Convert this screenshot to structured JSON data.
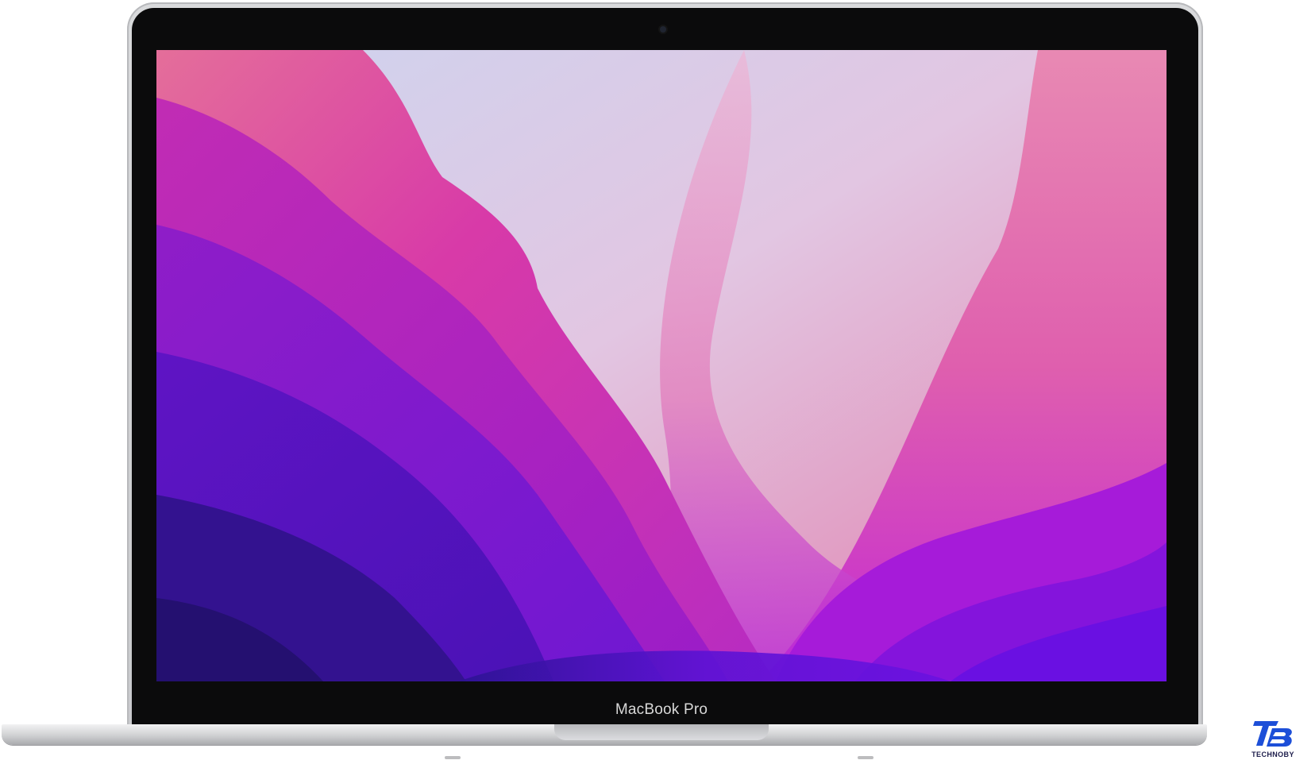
{
  "device": {
    "model_label": "MacBook Pro"
  },
  "watermark": {
    "brand_name": "TECHNOBY",
    "logo_letters": "TB"
  },
  "wallpaper": {
    "icon": "macos-monterey-wallpaper",
    "colors": {
      "deep_violet": "#3a13a6",
      "violet": "#6a16d0",
      "purple": "#9a1fd6",
      "magenta": "#c83bb6",
      "pink": "#e56aa4",
      "pale": "#e8cfe6"
    }
  },
  "colors": {
    "silver": "#d0d1d4",
    "bezel": "#0b0b0c",
    "logo_blue": "#1d4fd8"
  }
}
